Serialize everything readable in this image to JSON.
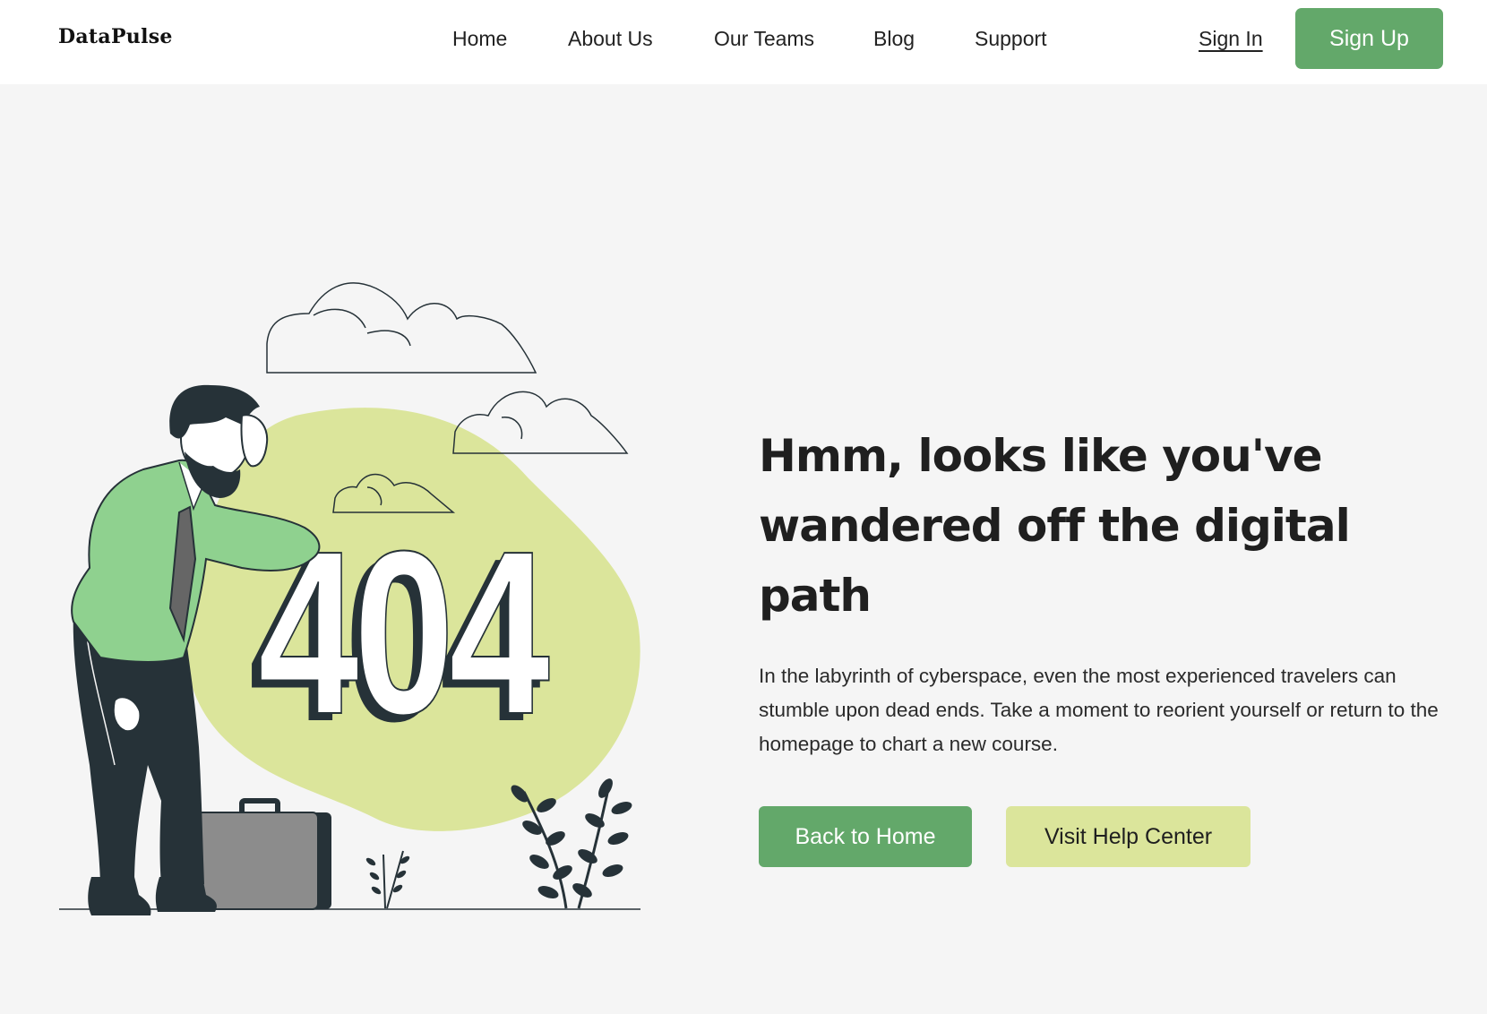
{
  "brand": {
    "name": "DataPulse"
  },
  "nav": {
    "items": [
      {
        "label": "Home"
      },
      {
        "label": "About Us"
      },
      {
        "label": "Our Teams"
      },
      {
        "label": "Blog"
      },
      {
        "label": "Support"
      }
    ],
    "sign_in": "Sign In",
    "sign_up": "Sign Up"
  },
  "hero": {
    "error_code": "404",
    "headline": "Hmm, looks like you've wandered off the digital path",
    "description": "In the labyrinth of cyberspace, even the most experienced travelers can stumble upon dead ends. Take a moment to reorient yourself or return to the homepage to chart a new course.",
    "primary_button": "Back to Home",
    "secondary_button": "Visit Help Center"
  },
  "colors": {
    "accent_green": "#63a86a",
    "light_lime": "#dbe59b",
    "shirt_green": "#8fd18f",
    "dark": "#263238",
    "background": "#f5f5f5"
  }
}
